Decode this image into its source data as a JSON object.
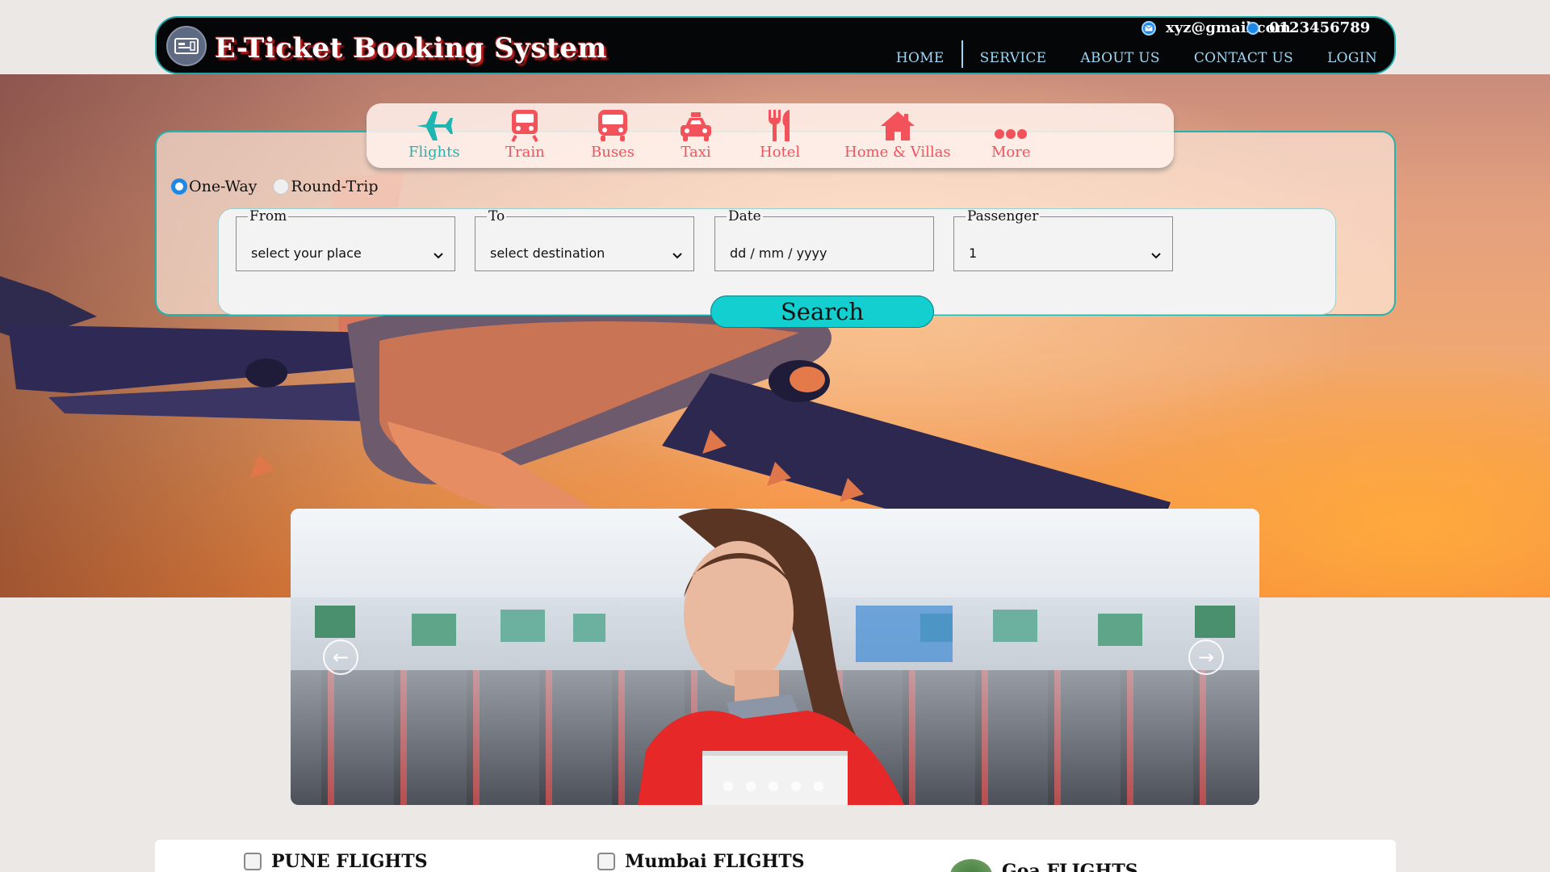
{
  "header": {
    "site_title": "E-Ticket Booking System",
    "email": "xyz@gmail.com",
    "phone": "0123456789",
    "nav": [
      "HOME",
      "SERVICE",
      "ABOUT US",
      "CONTACT US",
      "LOGIN"
    ]
  },
  "tabs": [
    {
      "label": "Flights",
      "icon": "plane-icon",
      "active": true
    },
    {
      "label": "Train",
      "icon": "train-icon",
      "active": false
    },
    {
      "label": "Buses",
      "icon": "bus-icon",
      "active": false
    },
    {
      "label": "Taxi",
      "icon": "taxi-icon",
      "active": false
    },
    {
      "label": "Hotel",
      "icon": "utensils-icon",
      "active": false
    },
    {
      "label": "Home & Villas",
      "icon": "home-icon",
      "active": false
    },
    {
      "label": "More",
      "icon": "more-dots-icon",
      "active": false
    }
  ],
  "trip_type": {
    "options": [
      "One-Way",
      "Round-Trip"
    ],
    "selected": "One-Way"
  },
  "form": {
    "from": {
      "label": "From",
      "value": "select your place"
    },
    "to": {
      "label": "To",
      "value": "select destination"
    },
    "date": {
      "label": "Date",
      "value": "dd / mm / yyyy"
    },
    "passenger": {
      "label": "Passenger",
      "value": "1"
    },
    "search_label": "Search"
  },
  "carousel": {
    "prev_icon": "arrow-left-icon",
    "next_icon": "arrow-right-icon",
    "slide_count": 5,
    "active_slide": 1
  },
  "destinations": [
    {
      "label": "PUNE FLIGHTS"
    },
    {
      "label": "Mumbai FLIGHTS"
    },
    {
      "label": "Goa FLIGHTS"
    }
  ],
  "colors": {
    "accent_teal": "#1fb5b0",
    "tab_red": "#f2525a",
    "search_button": "#13cfcf",
    "header_bg": "#050608",
    "nav_text": "#9fd8f5"
  }
}
